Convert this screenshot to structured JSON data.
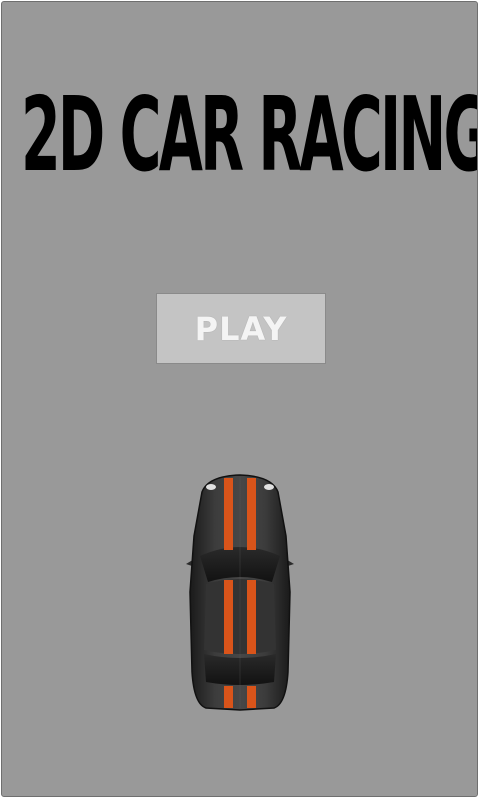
{
  "game": {
    "title": "2D CAR RACING",
    "play_label": "PLAY"
  },
  "colors": {
    "background": "#999999",
    "title": "#000000",
    "button": "#c4c4c4",
    "button_text": "#f4f4f4",
    "car_body": "#3a3a3a",
    "car_stripe": "#d9541a"
  }
}
